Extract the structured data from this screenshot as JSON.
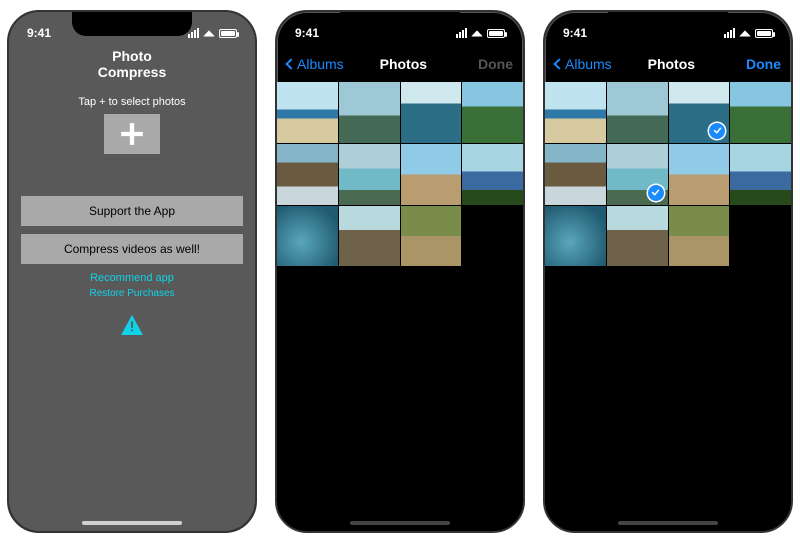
{
  "status": {
    "time": "9:41"
  },
  "screen1": {
    "title": "Photo Compress",
    "hint": "Tap + to select photos",
    "support_btn": "Support the App",
    "compress_btn": "Compress videos as well!",
    "recommend_link": "Recommend app",
    "restore_link": "Restore Purchases"
  },
  "photos": {
    "back_label": "Albums",
    "title": "Photos",
    "done_label": "Done"
  },
  "thumbs": [
    {
      "name": "beach-bay",
      "cls": "sky-beach"
    },
    {
      "name": "city-coast",
      "cls": "city-sea"
    },
    {
      "name": "boat-ocean",
      "cls": "sea-boat"
    },
    {
      "name": "green-hill",
      "cls": "green-hill"
    },
    {
      "name": "rock-waves",
      "cls": "rock-wave"
    },
    {
      "name": "pool-resort",
      "cls": "pool"
    },
    {
      "name": "sandy-shore",
      "cls": "shore"
    },
    {
      "name": "island-view",
      "cls": "island"
    },
    {
      "name": "snorkel",
      "cls": "underwater"
    },
    {
      "name": "cliffs",
      "cls": "cliffs"
    },
    {
      "name": "wallaby",
      "cls": "wallaby"
    }
  ],
  "selected_in_screen3": [
    2,
    5
  ]
}
